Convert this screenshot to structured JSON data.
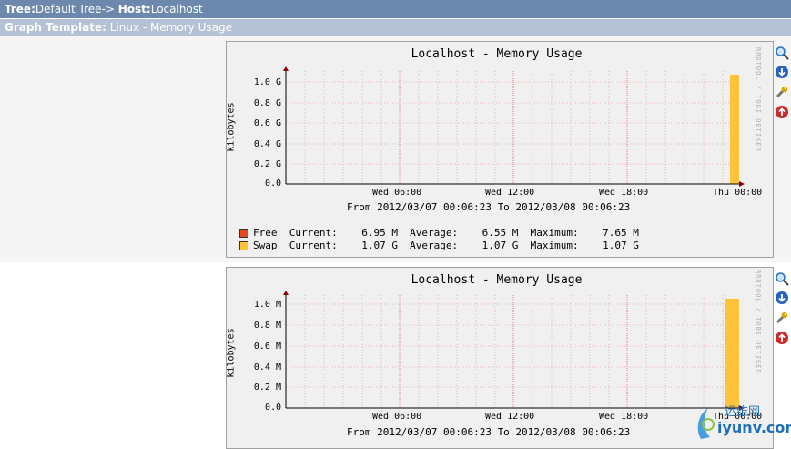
{
  "tree_bar": {
    "tree_label": "Tree:",
    "tree_value": "Default Tree->",
    "host_label": "Host:",
    "host_value": "Localhost"
  },
  "template_bar": {
    "label": "Graph Template:",
    "value": "Linux - Memory Usage"
  },
  "colors": {
    "header_blue": "#6d88ad",
    "subheader_blue": "#b5c2d6",
    "free": "#e34a1f",
    "swap": "#ffc33a",
    "zoom": "#2a72c2",
    "delete": "#cc2a2a"
  },
  "graphs": [
    {
      "title": "Localhost - Memory Usage",
      "ylabel": "kilobytes",
      "watermark": "RRDTOOL / TOBI OETIKER",
      "yticks": [
        "1.0 G",
        "0.8 G",
        "0.6 G",
        "0.4 G",
        "0.2 G",
        "0.0"
      ],
      "xticks": [
        "Wed 06:00",
        "Wed 12:00",
        "Wed 18:00",
        "Thu 00:00"
      ],
      "range": "From 2012/03/07 00:06:23 To 2012/03/08 00:06:23",
      "legend": [
        {
          "name": "Free",
          "line": "Free  Current:    6.95 M  Average:    6.55 M  Maximum:    7.65 M"
        },
        {
          "name": "Swap",
          "line": "Swap  Current:    1.07 G  Average:    1.07 G  Maximum:    1.07 G"
        }
      ]
    },
    {
      "title": "Localhost - Memory Usage",
      "ylabel": "kilobytes",
      "watermark": "RRDTOOL / TOBI OETIKER",
      "yticks": [
        "1.0 M",
        "0.8 M",
        "0.6 M",
        "0.4 M",
        "0.2 M",
        "0.0"
      ],
      "xticks": [
        "Wed 06:00",
        "Wed 12:00",
        "Wed 18:00",
        "Thu 00:00"
      ],
      "range": "From 2012/03/07 00:06:23 To 2012/03/08 00:06:23"
    }
  ],
  "chart_data": [
    {
      "type": "area",
      "title": "Localhost - Memory Usage",
      "ylabel": "kilobytes",
      "x_range": [
        "Wed 00:06",
        "Thu 00:06"
      ],
      "ylim": [
        0,
        1.1
      ],
      "yunit": "G",
      "series": [
        {
          "name": "Free",
          "current": "6.95 M",
          "average": "6.55 M",
          "maximum": "7.65 M"
        },
        {
          "name": "Swap",
          "current": "1.07 G",
          "average": "1.07 G",
          "maximum": "1.07 G"
        }
      ]
    },
    {
      "type": "area",
      "title": "Localhost - Memory Usage",
      "ylabel": "kilobytes",
      "x_range": [
        "Wed 00:06",
        "Thu 00:06"
      ],
      "ylim": [
        0,
        1.1
      ],
      "yunit": "M"
    }
  ],
  "watermark_site": {
    "name": "iyunv.com",
    "chinese": "运维网"
  }
}
